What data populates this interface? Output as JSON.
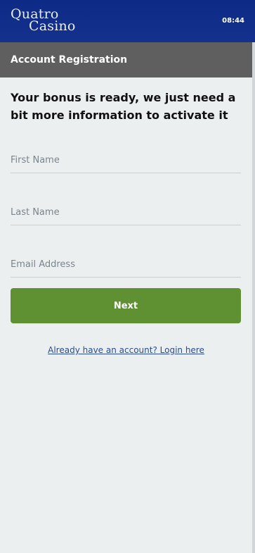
{
  "header": {
    "logo_line1": "Quatro",
    "logo_line2": "Casino",
    "time": "08:44"
  },
  "section": {
    "title": "Account Registration"
  },
  "intro": {
    "text": "Your bonus is ready, we just need a bit more information to activate it"
  },
  "form": {
    "first_name": {
      "value": "",
      "placeholder": "First Name"
    },
    "last_name": {
      "value": "",
      "placeholder": "Last Name"
    },
    "email": {
      "value": "",
      "placeholder": "Email Address"
    },
    "next_label": "Next"
  },
  "footer": {
    "login_link": "Already have an account? Login here"
  },
  "colors": {
    "topbar": "#0c2a86",
    "section_header": "#5f5f5f",
    "primary_button": "#5f9132",
    "link": "#2c4d93",
    "background": "#eceff0"
  }
}
